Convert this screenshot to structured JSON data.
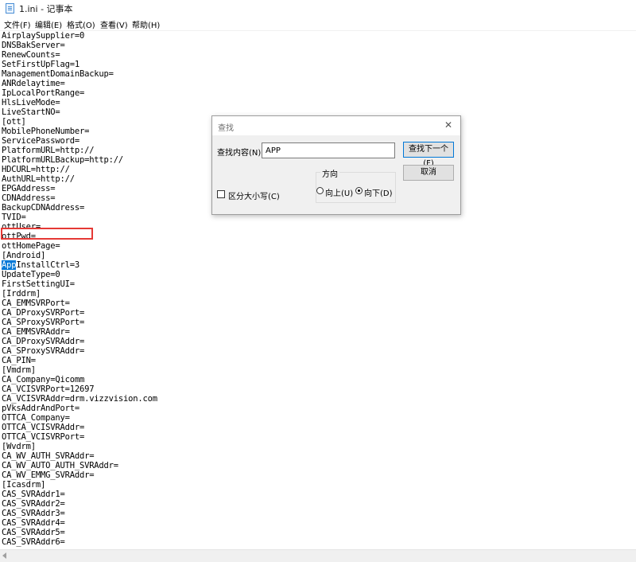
{
  "window": {
    "title": "1.ini - 记事本"
  },
  "menu": [
    "文件(F)",
    "编辑(E)",
    "格式(O)",
    "查看(V)",
    "帮助(H)"
  ],
  "editor": {
    "selected_text": "App",
    "lines": [
      "AirplaySupplier=0",
      "DNSBakServer=",
      "RenewCounts=",
      "SetFirstUpFlag=1",
      "ManagementDomainBackup=",
      "ANRdelaytime=",
      "IpLocalPortRange=",
      "HlsLiveMode=",
      "LiveStartNO=",
      "[ott]",
      "MobilePhoneNumber=",
      "ServicePassword=",
      "PlatformURL=http://",
      "PlatformURLBackup=http://",
      "HDCURL=http://",
      "AuthURL=http://",
      "EPGAddress=",
      "CDNAddress=",
      "BackupCDNAddress=",
      "TVID=",
      "ottUser=",
      "ottPwd=",
      "ottHomePage=",
      "[Android]",
      "AppInstallCtrl=3",
      "UpdateType=0",
      "FirstSettingUI=",
      "[Irddrm]",
      "CA_EMMSVRPort=",
      "CA_DProxySVRPort=",
      "CA_SProxySVRPort=",
      "CA_EMMSVRAddr=",
      "CA_DProxySVRAddr=",
      "CA_SProxySVRAddr=",
      "CA_PIN=",
      "[Vmdrm]",
      "CA_Company=Qicomm",
      "CA_VCISVRPort=12697",
      "CA_VCISVRAddr=drm.vizzvision.com",
      "pVksAddrAndPort=",
      "OTTCA_Company=",
      "OTTCA_VCISVRAddr=",
      "OTTCA_VCISVRPort=",
      "[Wvdrm]",
      "CA_WV_AUTH_SVRAddr=",
      "CA_WV_AUTO_AUTH_SVRAddr=",
      "CA_WV_EMMG_SVRAddr=",
      "[Icasdrm]",
      "CAS_SVRAddr1=",
      "CAS_SVRAddr2=",
      "CAS_SVRAddr3=",
      "CAS_SVRAddr4=",
      "CAS_SVRAddr5=",
      "CAS_SVRAddr6="
    ]
  },
  "find_dialog": {
    "title": "查找",
    "find_label": "查找内容(N):",
    "find_value": "APP",
    "find_next_label": "查找下一个(F)",
    "cancel_label": "取消",
    "direction_label": "方向",
    "up_label": "向上(U)",
    "down_label": "向下(D)",
    "direction_selected": "down",
    "match_case_label": "区分大小写(C)",
    "match_case_checked": false
  }
}
